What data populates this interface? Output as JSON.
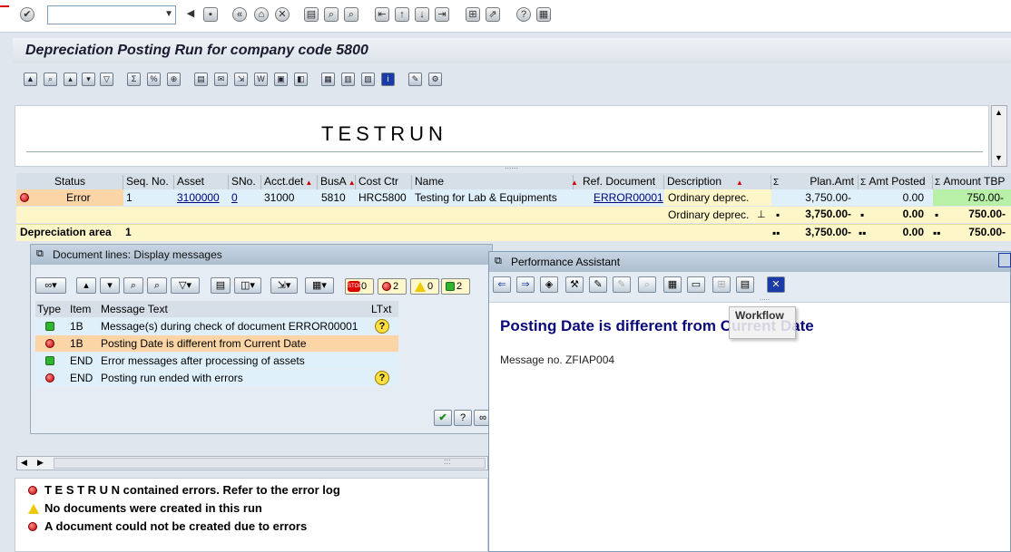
{
  "toolbar": {
    "command_field_value": "",
    "icons": [
      "checkmark-icon",
      "back-icon",
      "save-icon",
      "back-nav-icon",
      "exit-icon",
      "cancel-icon",
      "print-icon",
      "find-icon",
      "find-next-icon",
      "first-page-icon",
      "prev-page-icon",
      "next-page-icon",
      "last-page-icon",
      "new-session-icon",
      "shortcut-icon",
      "help-icon",
      "layout-icon"
    ]
  },
  "page": {
    "title": "Depreciation Posting Run for company code 5800",
    "header_label": "TESTRUN"
  },
  "table": {
    "headers": {
      "status": "Status",
      "seq_no": "Seq. No.",
      "asset": "Asset",
      "sno": "SNo.",
      "acct_det": "Acct.det",
      "busa": "BusA",
      "cost_ctr": "Cost Ctr",
      "name": "Name",
      "ref_doc": "Ref. Document",
      "description": "Description",
      "plan_amt": "Plan.Amt",
      "amt_posted": "Amt Posted",
      "amount_tbp": "Amount TBP",
      "sigma": "Σ"
    },
    "row1": {
      "status": "Error",
      "seq_no": "1",
      "asset": "3100000",
      "sno": "0",
      "acct_det": "31000",
      "busa": "5810",
      "cost_ctr": "HRC5800",
      "name": "Testing for Lab & Equipments",
      "ref_doc": "ERROR00001",
      "description": "Ordinary deprec.",
      "plan_amt": "3,750.00-",
      "amt_posted": "0.00",
      "amount_tbp": "750.00-"
    },
    "row2": {
      "description": "Ordinary deprec.",
      "plan_amt": "3,750.00-",
      "amt_posted": "0.00",
      "amount_tbp": "750.00-"
    },
    "row3": {
      "label": "Depreciation area",
      "value": "1",
      "plan_amt": "3,750.00-",
      "amt_posted": "0.00",
      "amount_tbp": "750.00-"
    }
  },
  "doc_dialog": {
    "title": "Document lines: Display messages",
    "counts": {
      "stop": "0",
      "error": "2",
      "warning": "0",
      "ok": "2"
    },
    "headers": {
      "type": "Type",
      "item": "Item",
      "text": "Message Text",
      "ltxt": "LTxt"
    },
    "messages": [
      {
        "type": "ok",
        "item": "1B",
        "text": "Message(s) during check of document ERROR00001",
        "has_ltxt": true
      },
      {
        "type": "error",
        "item": "1B",
        "text": "Posting Date is different from Current Date",
        "has_ltxt": false
      },
      {
        "type": "ok",
        "item": "END",
        "text": "Error messages after processing of assets",
        "has_ltxt": false
      },
      {
        "type": "error",
        "item": "END",
        "text": "Posting run ended with errors",
        "has_ltxt": true
      }
    ]
  },
  "perf_assistant": {
    "title": "Performance Assistant",
    "heading": "Posting Date is different from Current Date",
    "message_no": "Message no. ZFIAP004",
    "tooltip": "Workflow"
  },
  "log": {
    "lines": [
      {
        "type": "error",
        "text": "T E S T R U N contained errors. Refer to the error log"
      },
      {
        "type": "warning",
        "text": "No documents were created in this run"
      },
      {
        "type": "error",
        "text": "A document could not be created due to errors"
      }
    ]
  },
  "colors": {
    "error_row": "#fbd5a5",
    "yellow_row": "#fdf6c8",
    "blue_row": "#dff0fb",
    "green_cell": "#b9f0a8",
    "heading_blue": "#0a0a7a"
  }
}
